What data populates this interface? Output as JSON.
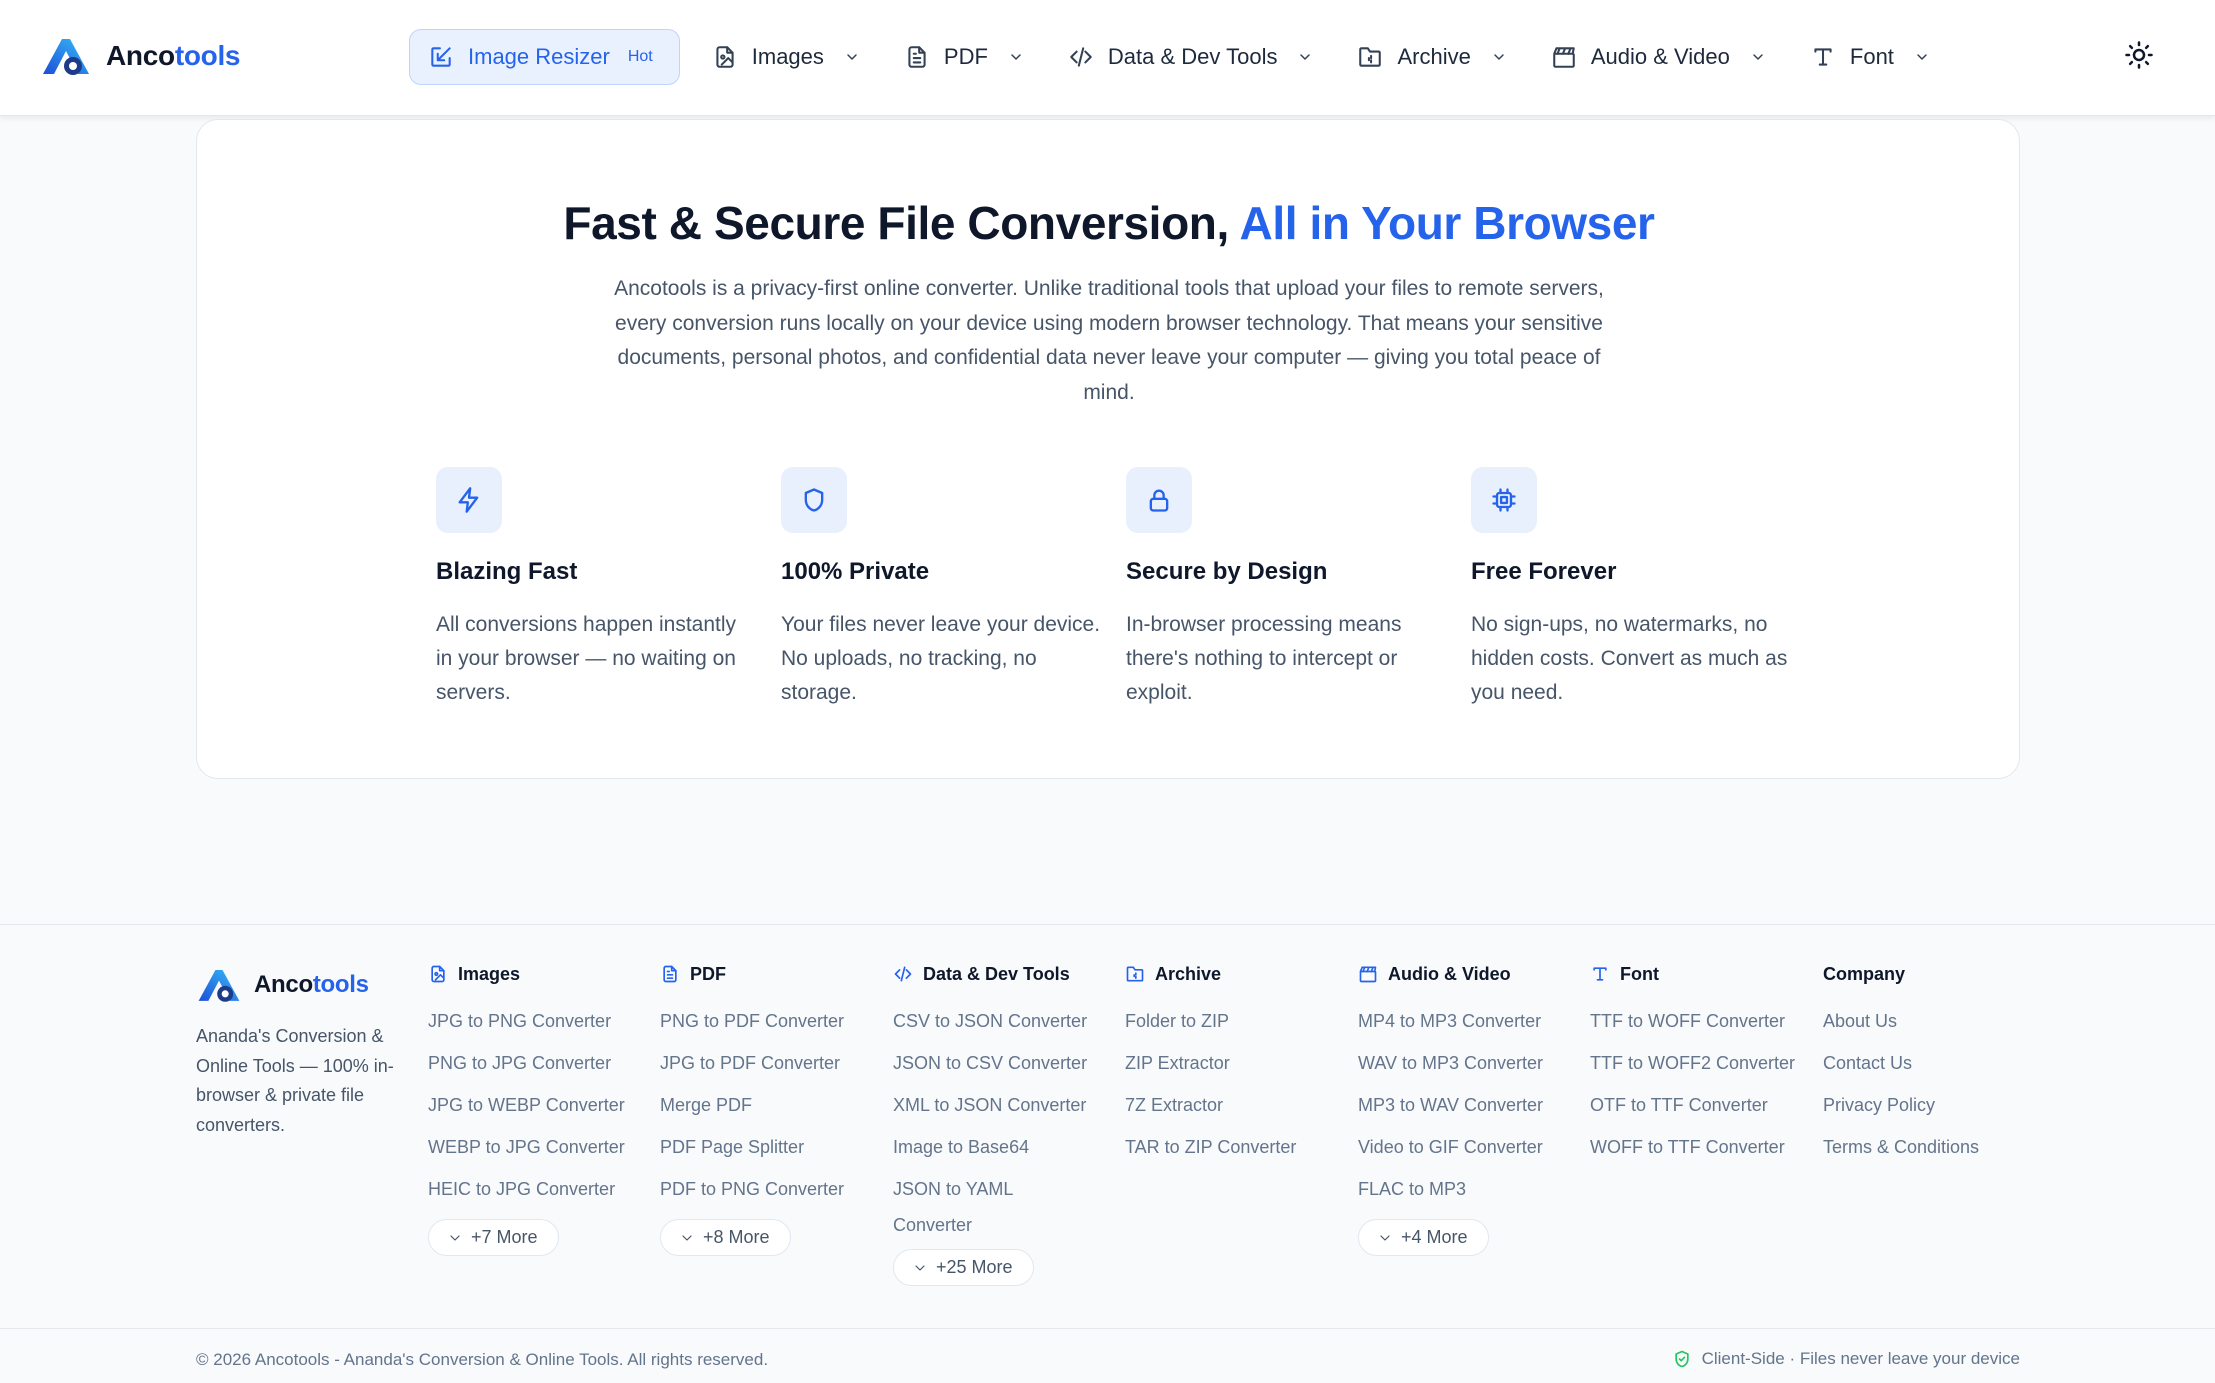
{
  "header": {
    "logo": {
      "part1": "Anco",
      "part2": "tools"
    },
    "nav": [
      {
        "label": "Image Resizer",
        "badge": "Hot",
        "icon": "external-edit-icon"
      },
      {
        "label": "Images",
        "icon": "image-file-icon"
      },
      {
        "label": "PDF",
        "icon": "document-icon"
      },
      {
        "label": "Data & Dev Tools",
        "icon": "code-icon"
      },
      {
        "label": "Archive",
        "icon": "archive-folder-icon"
      },
      {
        "label": "Audio & Video",
        "icon": "clapperboard-icon"
      },
      {
        "label": "Font",
        "icon": "type-icon"
      }
    ],
    "theme_icon": "sun-icon"
  },
  "hero": {
    "title_plain": "Fast & Secure File Conversion,",
    "title_accent": "All in Your Browser",
    "description": "Ancotools is a privacy-first online converter. Unlike traditional tools that upload your files to remote servers, every conversion runs locally on your device using modern browser technology. That means your sensitive documents, personal photos, and confidential data never leave your computer — giving you total peace of mind."
  },
  "features": [
    {
      "icon": "lightning-icon",
      "title": "Blazing Fast",
      "text": "All conversions happen instantly in your browser — no waiting on servers."
    },
    {
      "icon": "shield-icon",
      "title": "100% Private",
      "text": "Your files never leave your device. No uploads, no tracking, no storage."
    },
    {
      "icon": "lock-icon",
      "title": "Secure by Design",
      "text": "In-browser processing means there's nothing to intercept or exploit."
    },
    {
      "icon": "chip-icon",
      "title": "Free Forever",
      "text": "No sign-ups, no watermarks, no hidden costs. Convert as much as you need."
    }
  ],
  "footer": {
    "brand": {
      "part1": "Anco",
      "part2": "tools",
      "tagline": "Ananda's Conversion & Online Tools — 100% in-browser & private file converters."
    },
    "columns": [
      {
        "title": "Images",
        "icon": "image-file-icon",
        "links": [
          "JPG to PNG Converter",
          "PNG to JPG Converter",
          "JPG to WEBP Converter",
          "WEBP to JPG Converter",
          "HEIC to JPG Converter"
        ],
        "more": "+7 More"
      },
      {
        "title": "PDF",
        "icon": "document-icon",
        "links": [
          "PNG to PDF Converter",
          "JPG to PDF Converter",
          "Merge PDF",
          "PDF Page Splitter",
          "PDF to PNG Converter"
        ],
        "more": "+8 More"
      },
      {
        "title": "Data & Dev Tools",
        "icon": "code-icon",
        "links": [
          "CSV to JSON Converter",
          "JSON to CSV Converter",
          "XML to JSON Converter",
          "Image to Base64",
          "JSON to YAML Converter"
        ],
        "more": "+25 More"
      },
      {
        "title": "Archive",
        "icon": "archive-folder-icon",
        "links": [
          "Folder to ZIP",
          "ZIP Extractor",
          "7Z Extractor",
          "TAR to ZIP Converter"
        ]
      },
      {
        "title": "Audio & Video",
        "icon": "clapperboard-icon",
        "links": [
          "MP4 to MP3 Converter",
          "WAV to MP3 Converter",
          "MP3 to WAV Converter",
          "Video to GIF Converter",
          "FLAC to MP3"
        ],
        "more": "+4 More"
      },
      {
        "title": "Font",
        "icon": "type-icon",
        "links": [
          "TTF to WOFF Converter",
          "TTF to WOFF2 Converter",
          "OTF to TTF Converter",
          "WOFF to TTF Converter"
        ]
      },
      {
        "title": "Company",
        "links": [
          "About Us",
          "Contact Us",
          "Privacy Policy",
          "Terms & Conditions"
        ]
      }
    ],
    "copyright": "© 2026 Ancotools - Ananda's Conversion & Online Tools. All rights reserved.",
    "client_side": "Client-Side · Files never leave your device"
  },
  "colors": {
    "accent": "#2563eb",
    "text": "#0f172a",
    "muted": "#64748b",
    "safe": "#22c55e"
  }
}
